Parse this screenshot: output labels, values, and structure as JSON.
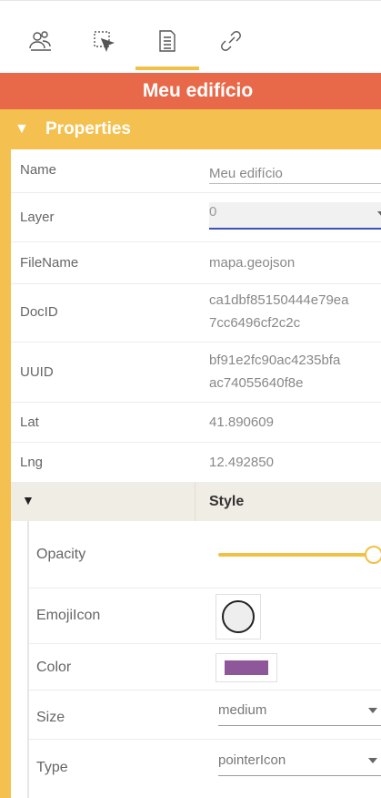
{
  "toolbar": {
    "buttons": [
      {
        "icon": "users-icon"
      },
      {
        "icon": "select-cursor-icon"
      },
      {
        "icon": "document-list-icon",
        "active": true
      },
      {
        "icon": "link-icon"
      }
    ]
  },
  "title": "Meu edifício",
  "section": {
    "toggle": "▼",
    "label": "Properties"
  },
  "properties": {
    "name": {
      "label": "Name",
      "value": "Meu edifício"
    },
    "layer": {
      "label": "Layer",
      "value": "0"
    },
    "filename": {
      "label": "FileName",
      "value": "mapa.geojson"
    },
    "docid": {
      "label": "DocID",
      "line1": "ca1dbf85150444e79ea",
      "line2": "7cc6496cf2c2c"
    },
    "uuid": {
      "label": "UUID",
      "line1": "bf91e2fc90ac4235bfa",
      "line2": "ac74055640f8e"
    },
    "lat": {
      "label": "Lat",
      "value": "41.890609"
    },
    "lng": {
      "label": "Lng",
      "value": "12.492850"
    }
  },
  "style": {
    "toggle": "▼",
    "title": "Style",
    "opacity": {
      "label": "Opacity",
      "level": 1.0
    },
    "emoji": {
      "label": "EmojiIcon"
    },
    "color": {
      "label": "Color",
      "swatch": "#8e579a"
    },
    "size": {
      "label": "Size",
      "value": "medium"
    },
    "type": {
      "label": "Type",
      "value": "pointerIcon"
    }
  },
  "colors": {
    "accent": "#f4c150",
    "header": "#e8694a",
    "focus": "#3f51b5"
  }
}
